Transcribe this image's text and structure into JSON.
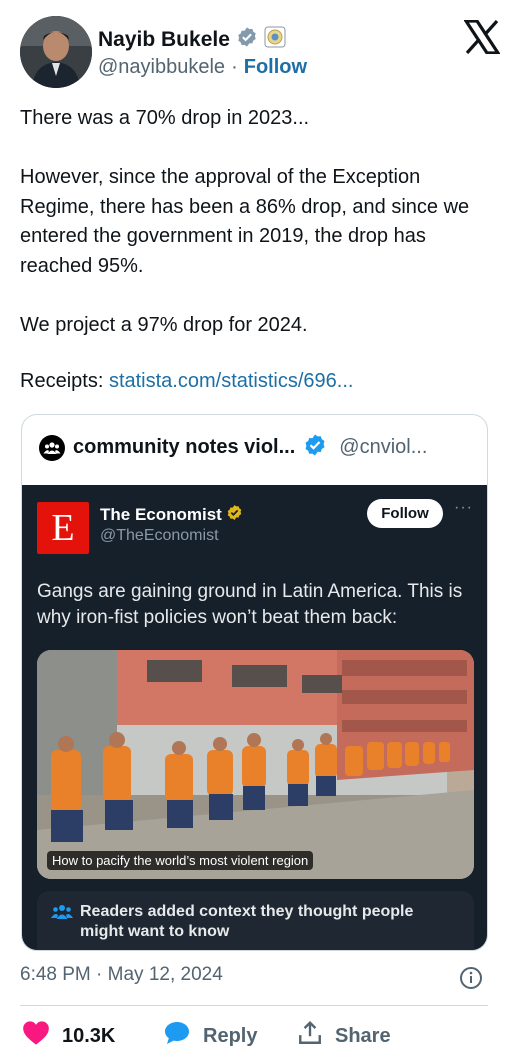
{
  "author": {
    "name": "Nayib Bukele",
    "handle": "@nayibbukele",
    "separator": "·",
    "follow_label": "Follow"
  },
  "tweet": {
    "body": "There was a 70% drop in 2023...\n\nHowever, since the approval of the Exception Regime, there has been a 86% drop, and since we entered the government in 2019, the drop has reached 95%.\n\nWe project a 97% drop for 2024.",
    "receipts_label": "Receipts:",
    "receipts_link": "statista.com/statistics/696..."
  },
  "quote": {
    "name": "community notes viol...",
    "handle": "@cnviol...",
    "embedded": {
      "logo_letter": "E",
      "name": "The Economist",
      "handle": "@TheEconomist",
      "follow_label": "Follow",
      "more_label": "···",
      "text": "Gangs are gaining ground in Latin America. This is why iron-fist policies won’t beat them back:",
      "image_caption": "How to pacify the world’s most violent region",
      "note_text": "Readers added context they thought people might want to know"
    }
  },
  "meta": {
    "timestamp": "6:48 PM · May 12, 2024"
  },
  "actions": {
    "like_count": "10.3K",
    "reply_label": "Reply",
    "share_label": "Share"
  },
  "colors": {
    "link": "#1d6fa5",
    "like": "#f91880",
    "reply": "#1d9bf0",
    "verified_blue": "#1d9bf0",
    "verified_gold": "#e2b719",
    "economist_red": "#e3120b"
  },
  "icons": [
    "verified-badge-icon",
    "affiliate-seal-icon",
    "x-logo-icon",
    "community-notes-icon",
    "gold-verified-icon",
    "info-icon",
    "heart-icon",
    "reply-bubble-icon",
    "share-icon",
    "readers-icon"
  ]
}
